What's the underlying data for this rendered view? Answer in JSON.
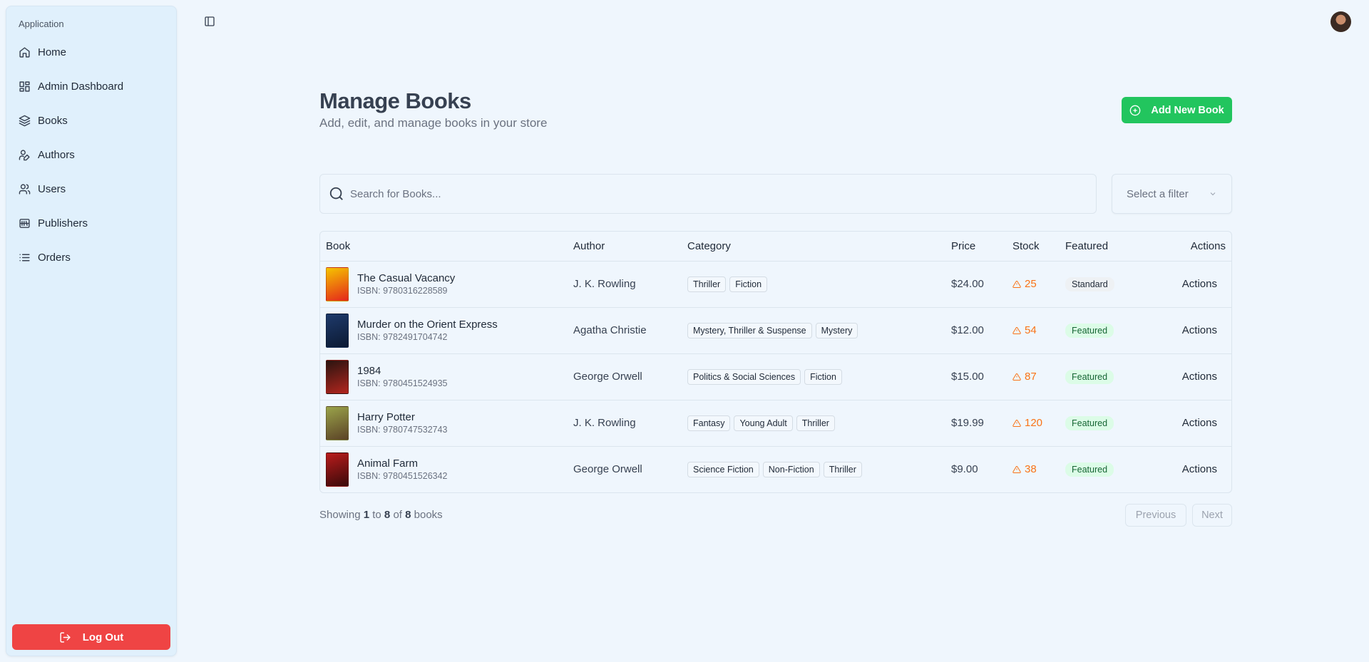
{
  "sidebar": {
    "group_label": "Application",
    "items": [
      {
        "label": "Home",
        "icon": "home-icon"
      },
      {
        "label": "Admin Dashboard",
        "icon": "dashboard-icon"
      },
      {
        "label": "Books",
        "icon": "layers-icon"
      },
      {
        "label": "Authors",
        "icon": "author-pen-icon"
      },
      {
        "label": "Users",
        "icon": "users-icon"
      },
      {
        "label": "Publishers",
        "icon": "library-icon"
      },
      {
        "label": "Orders",
        "icon": "list-icon"
      }
    ],
    "logout_label": "Log Out"
  },
  "header": {
    "title": "Manage Books",
    "subtitle": "Add, edit, and manage books in your store",
    "add_button": "Add New Book"
  },
  "search": {
    "placeholder": "Search for Books...",
    "value": ""
  },
  "filter": {
    "placeholder": "Select a filter"
  },
  "table": {
    "columns": [
      "Book",
      "Author",
      "Category",
      "Price",
      "Stock",
      "Featured",
      "Actions"
    ],
    "rows": [
      {
        "title": "The Casual Vacancy",
        "isbn": "ISBN: 9780316228589",
        "author": "J. K. Rowling",
        "categories": [
          "Thriller",
          "Fiction"
        ],
        "price": "$24.00",
        "stock": "25",
        "featured": "Standard",
        "actions": "Actions",
        "cover_colors": [
          "#f5c400",
          "#e4271b"
        ]
      },
      {
        "title": "Murder on the Orient Express",
        "isbn": "ISBN: 9782491704742",
        "author": "Agatha Christie",
        "categories": [
          "Mystery, Thriller & Suspense",
          "Mystery"
        ],
        "price": "$12.00",
        "stock": "54",
        "featured": "Featured",
        "actions": "Actions",
        "cover_colors": [
          "#1e3a6b",
          "#0c1a33"
        ]
      },
      {
        "title": "1984",
        "isbn": "ISBN: 9780451524935",
        "author": "George Orwell",
        "categories": [
          "Politics & Social Sciences",
          "Fiction"
        ],
        "price": "$15.00",
        "stock": "87",
        "featured": "Featured",
        "actions": "Actions",
        "cover_colors": [
          "#2a1410",
          "#b3261e"
        ]
      },
      {
        "title": "Harry Potter",
        "isbn": "ISBN: 9780747532743",
        "author": "J. K. Rowling",
        "categories": [
          "Fantasy",
          "Young Adult",
          "Thriller"
        ],
        "price": "$19.99",
        "stock": "120",
        "featured": "Featured",
        "actions": "Actions",
        "cover_colors": [
          "#9aa34a",
          "#5b4226"
        ]
      },
      {
        "title": "Animal Farm",
        "isbn": "ISBN: 9780451526342",
        "author": "George Orwell",
        "categories": [
          "Science Fiction",
          "Non-Fiction",
          "Thriller"
        ],
        "price": "$9.00",
        "stock": "38",
        "featured": "Featured",
        "actions": "Actions",
        "cover_colors": [
          "#b91c1c",
          "#3a0a0a"
        ]
      }
    ]
  },
  "pagination": {
    "showing_prefix": "Showing",
    "from": "1",
    "to_word": "to",
    "to": "8",
    "of_word": "of",
    "total": "8",
    "suffix": "books",
    "previous": "Previous",
    "next": "Next"
  },
  "colors": {
    "accent_green": "#22c55e",
    "danger_red": "#ef4444",
    "stock_orange": "#f97316"
  }
}
